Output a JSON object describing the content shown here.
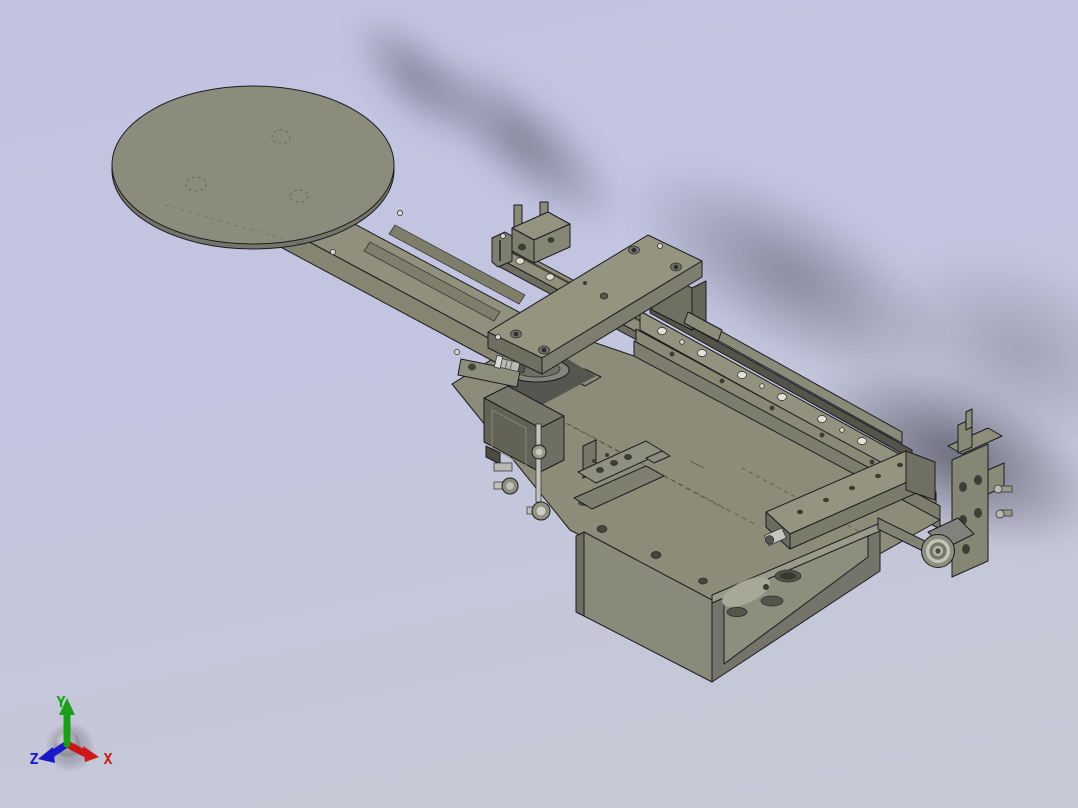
{
  "viewport": {
    "background_top": "#c2c3e1",
    "background_bottom": "#c6c9d3",
    "model_fill": "#8f8f7d",
    "model_fill_side": "#7b7b6c",
    "model_fill_dark": "#5e5e54",
    "outline_color": "#1c1c22",
    "screw_silver": "#c8c8c2"
  },
  "axis_triad": {
    "x": {
      "label": "X",
      "color": "#cc2020"
    },
    "y": {
      "label": "Y",
      "color": "#00a800"
    },
    "z": {
      "label": "Z",
      "color": "#2020cc"
    }
  },
  "model": {
    "parts": [
      {
        "name": "turntable-disc"
      },
      {
        "name": "rotary-arm"
      },
      {
        "name": "rotary-bearing"
      },
      {
        "name": "y-axis-rail"
      },
      {
        "name": "motor-mount-block"
      },
      {
        "name": "cross-slide-plate"
      },
      {
        "name": "x-axis-rail-assembly"
      },
      {
        "name": "base-deck"
      },
      {
        "name": "base-box"
      },
      {
        "name": "z-axis-actuator"
      },
      {
        "name": "adjustment-knobs"
      },
      {
        "name": "sensor-bracket"
      },
      {
        "name": "tab-bracket"
      },
      {
        "name": "x-carriage-plate"
      },
      {
        "name": "drive-roller"
      },
      {
        "name": "end-bracket"
      }
    ]
  }
}
